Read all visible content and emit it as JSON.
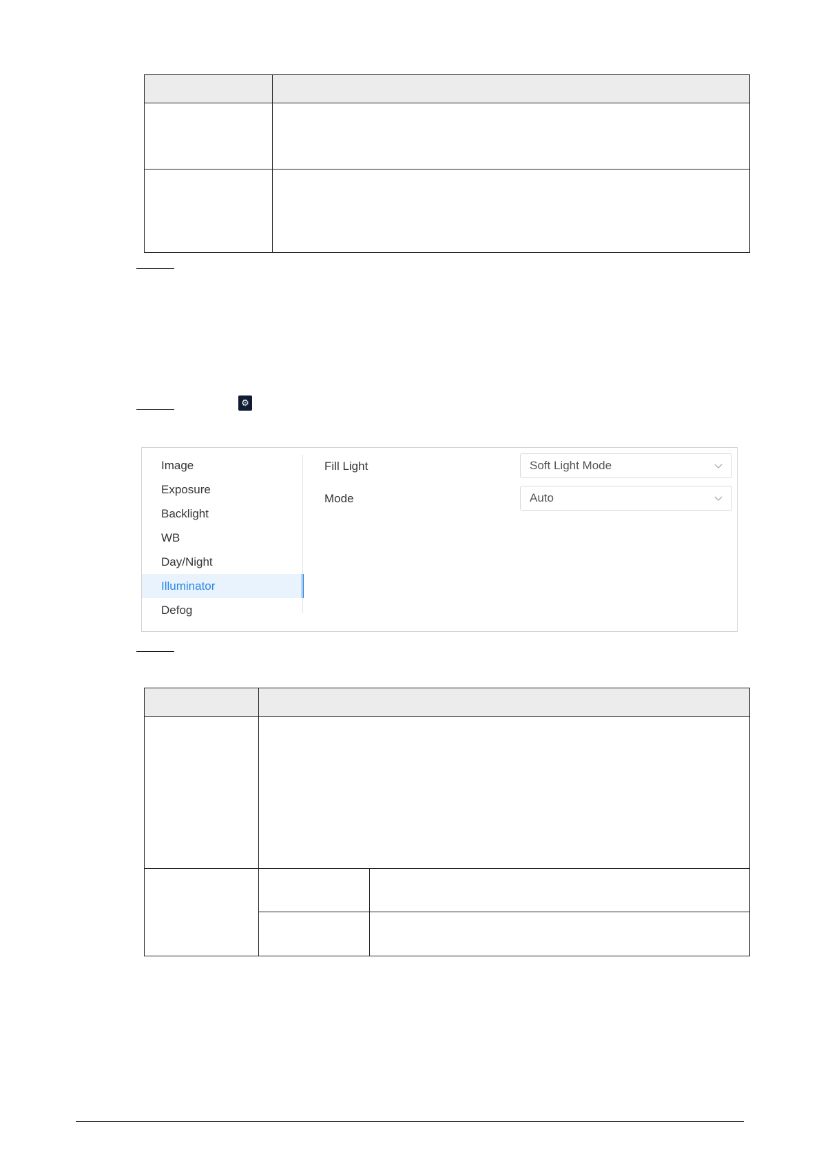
{
  "panel": {
    "sidebar": [
      {
        "label": "Image",
        "active": false
      },
      {
        "label": "Exposure",
        "active": false
      },
      {
        "label": "Backlight",
        "active": false
      },
      {
        "label": "WB",
        "active": false
      },
      {
        "label": "Day/Night",
        "active": false
      },
      {
        "label": "Illuminator",
        "active": true
      },
      {
        "label": "Defog",
        "active": false
      }
    ],
    "fill_light": {
      "label": "Fill Light",
      "value": "Soft Light Mode"
    },
    "mode": {
      "label": "Mode",
      "value": "Auto"
    }
  },
  "colors": {
    "accent": "#2b87e3",
    "active_bg": "#e9f3fd",
    "header_bg": "#ececec"
  },
  "icons": {
    "settings": "gear-icon",
    "dropdown": "chevron-down-icon"
  }
}
